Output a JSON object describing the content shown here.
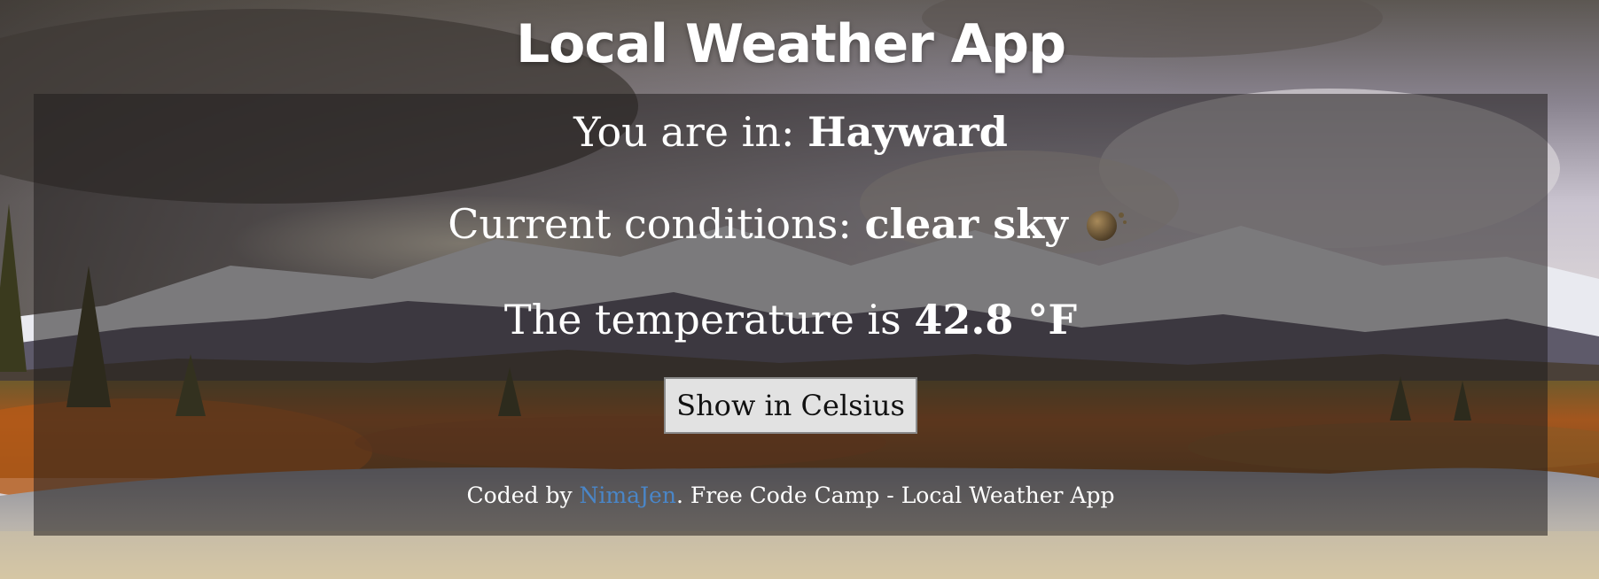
{
  "app": {
    "title": "Local Weather App"
  },
  "location": {
    "prefix": "You are in: ",
    "city": "Hayward"
  },
  "conditions": {
    "prefix": "Current conditions: ",
    "value": "clear sky",
    "icon": "clear-sky-weather-icon"
  },
  "temperature": {
    "prefix": "The temperature is ",
    "value": "42.8 °F"
  },
  "toggle_button": {
    "label": "Show in Celsius"
  },
  "footer": {
    "prefix": "Coded by ",
    "author": "NimaJen",
    "suffix": ". Free Code Camp - Local Weather App"
  },
  "colors": {
    "panel": "#201e1e",
    "link": "#4a86c8",
    "button": "#e2e2e2"
  }
}
